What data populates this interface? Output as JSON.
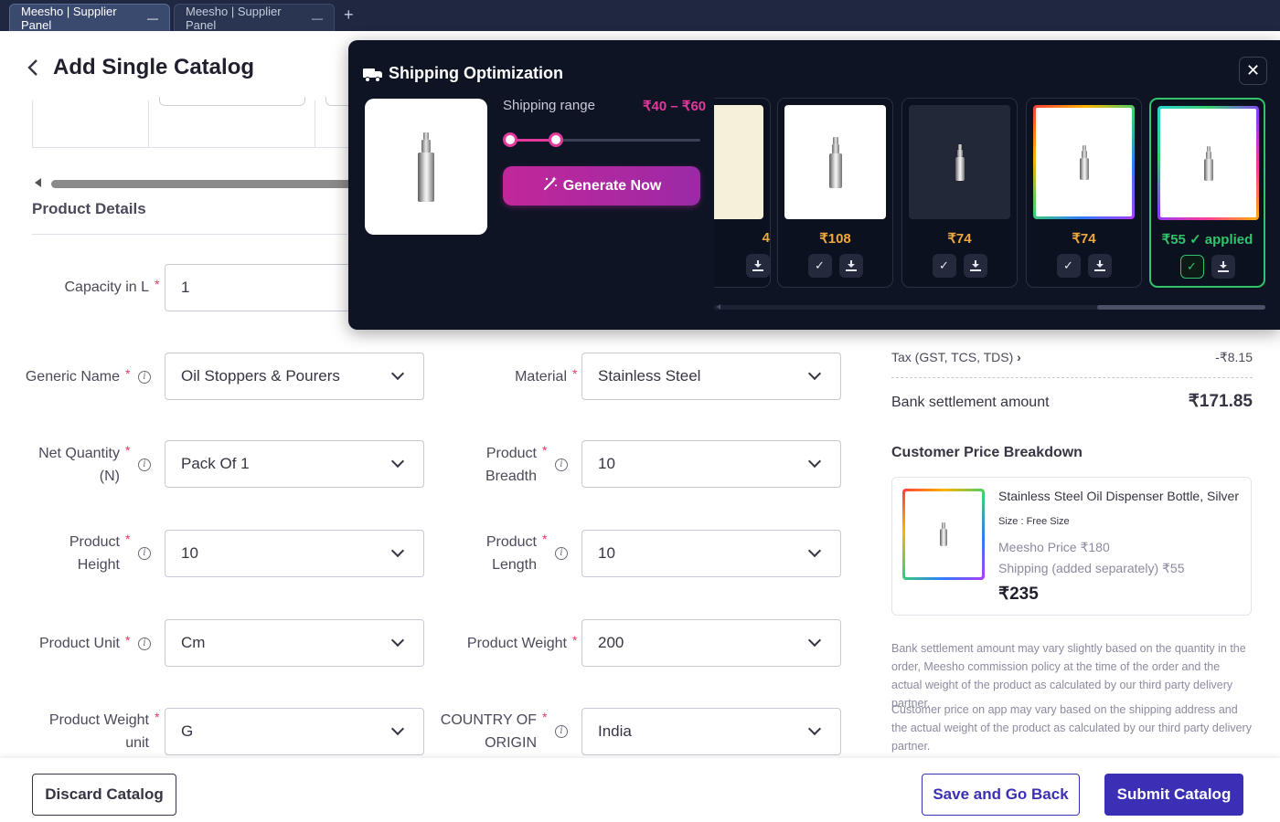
{
  "browser": {
    "tabs": [
      {
        "label": "Meesho | Supplier Panel",
        "active": true
      },
      {
        "label": "Meesho | Supplier Panel",
        "active": false
      }
    ],
    "new_tab": "+",
    "close_glyph": "—"
  },
  "header": {
    "title": "Add Single Catalog",
    "back_icon": "chevron-left-icon"
  },
  "section": {
    "title": "Product Details"
  },
  "form": {
    "capacity": {
      "label": "Capacity in L",
      "value": "1"
    },
    "generic_name": {
      "label": "Generic Name",
      "value": "Oil Stoppers & Pourers"
    },
    "material": {
      "label": "Material",
      "value": "Stainless Steel"
    },
    "net_quantity": {
      "label_line1": "Net Quantity",
      "label_line2": "(N)",
      "value": "Pack Of 1"
    },
    "product_breadth": {
      "label_line1": "Product",
      "label_line2": "Breadth",
      "value": "10"
    },
    "product_height": {
      "label_line1": "Product",
      "label_line2": "Height",
      "value": "10"
    },
    "product_length": {
      "label_line1": "Product",
      "label_line2": "Length",
      "value": "10"
    },
    "product_unit": {
      "label": "Product Unit",
      "value": "Cm"
    },
    "product_weight": {
      "label": "Product Weight",
      "value": "200"
    },
    "product_weight_unit": {
      "label_line1": "Product Weight",
      "label_line2": "unit",
      "value": "G"
    },
    "country_of_origin": {
      "label_line1": "COUNTRY OF",
      "label_line2": "ORIGIN",
      "value": "India"
    },
    "required_mark": "*",
    "info_glyph": "i"
  },
  "price_panel": {
    "tax_label": "Tax (GST, TCS, TDS)",
    "tax_value": "-₹8.15",
    "settlement_label": "Bank settlement amount",
    "settlement_value": "₹171.85",
    "breakdown_title": "Customer Price Breakdown",
    "product_name": "Stainless Steel Oil Dispenser Bottle, Silver",
    "size": "Size : Free Size",
    "meesho_price": "Meesho Price ₹180",
    "shipping": "Shipping (added separately) ₹55",
    "total": "₹235",
    "note1": "Bank settlement amount may vary slightly based on the quantity in the order, Meesho commission policy at the time of the order and the actual weight of the product as calculated by our third party delivery partner.",
    "note2": "Customer price on app may vary based on the shipping address and the actual weight of the product as calculated by our third party delivery partner."
  },
  "shipping_popup": {
    "title": "Shipping Optimization",
    "range_label": "Shipping range",
    "range_value": "₹40 – ₹60",
    "range_low": 40,
    "range_high": 60,
    "generate_label": "Generate Now",
    "close_glyph": "✕",
    "options": [
      {
        "price": "4",
        "style": "cream",
        "selected": false
      },
      {
        "price": "₹108",
        "style": "white",
        "selected": false
      },
      {
        "price": "₹74",
        "style": "dark",
        "selected": false
      },
      {
        "price": "₹74",
        "style": "rainbow",
        "selected": false
      },
      {
        "price": "₹55 ✓ applied",
        "style": "rainbow2",
        "selected": true
      }
    ]
  },
  "footer": {
    "discard": "Discard Catalog",
    "save": "Save and Go Back",
    "submit": "Submit Catalog"
  },
  "colors": {
    "primary": "#3b2fb5",
    "accent_pink": "#e2399b",
    "price_orange": "#f0a83a",
    "applied_green": "#31c46a",
    "popup_bg": "#0f1425"
  }
}
